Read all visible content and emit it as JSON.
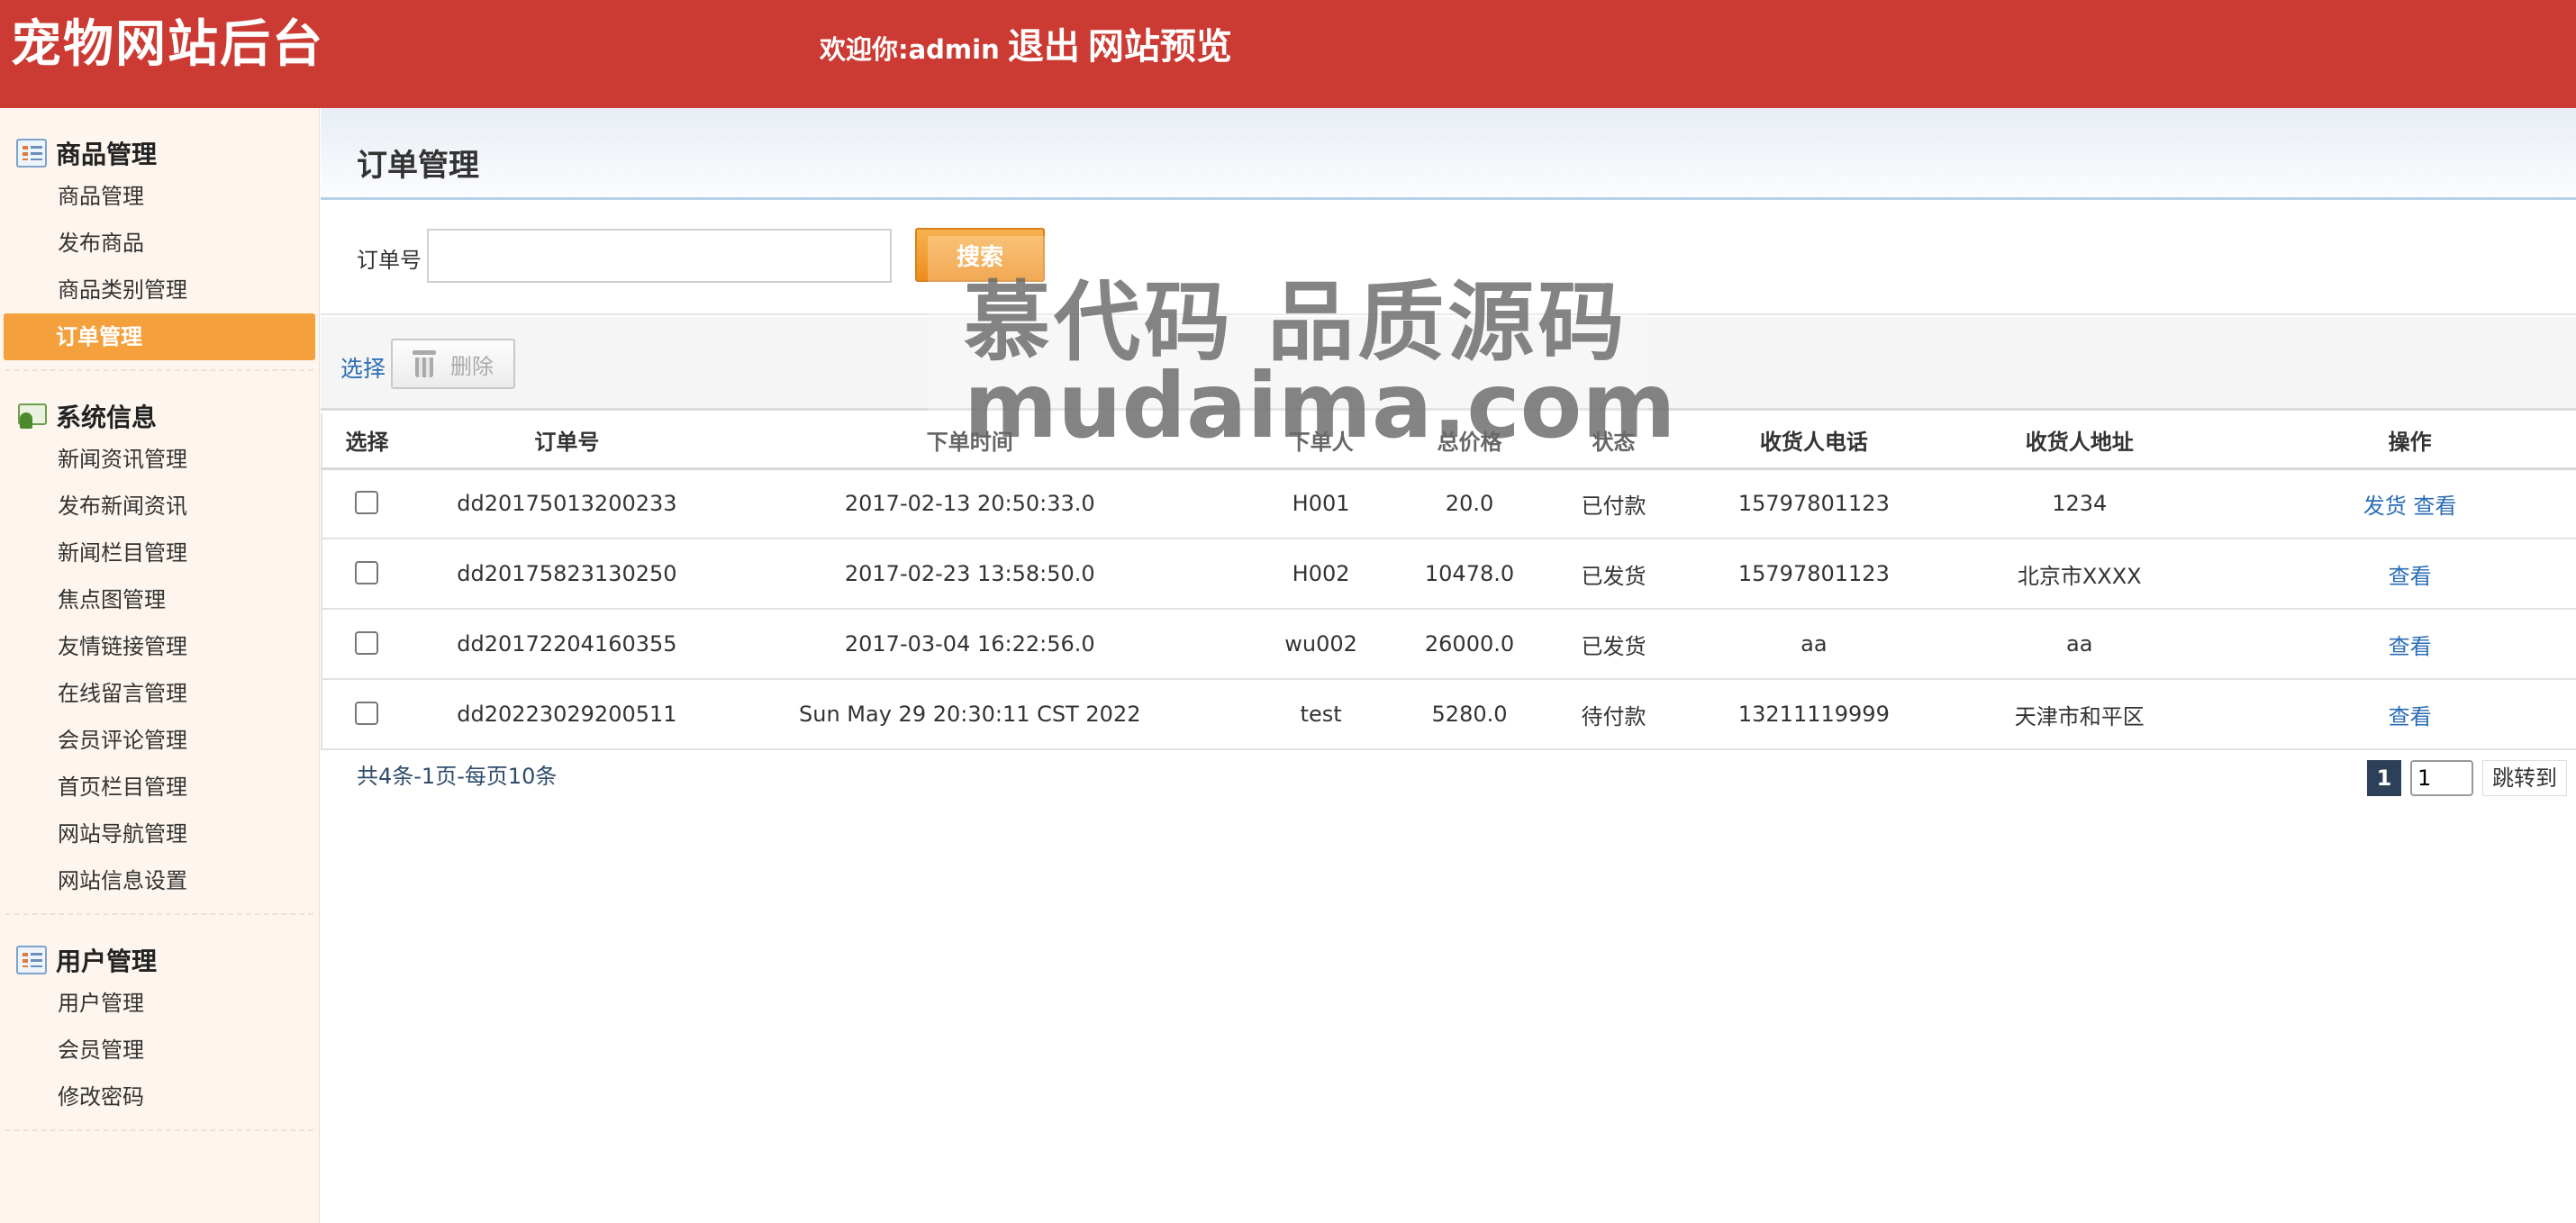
{
  "header": {
    "site_title": "宠物网站后台",
    "welcome": "欢迎你:admin",
    "logout": "退出",
    "preview": "网站预览"
  },
  "sidebar": {
    "groups": [
      {
        "title": "商品管理",
        "icon": "list-icon",
        "items": [
          "商品管理",
          "发布商品",
          "商品类别管理",
          "订单管理"
        ]
      },
      {
        "title": "系统信息",
        "icon": "people-icon",
        "items": [
          "新闻资讯管理",
          "发布新闻资讯",
          "新闻栏目管理",
          "焦点图管理",
          "友情链接管理",
          "在线留言管理",
          "会员评论管理",
          "首页栏目管理",
          "网站导航管理",
          "网站信息设置"
        ]
      },
      {
        "title": "用户管理",
        "icon": "list-icon",
        "items": [
          "用户管理",
          "会员管理",
          "修改密码"
        ]
      }
    ],
    "active_item": "订单管理"
  },
  "main": {
    "page_title": "订单管理",
    "search": {
      "label": "订单号",
      "value": "",
      "placeholder": "",
      "button": "搜索"
    },
    "toolbar": {
      "select": "选择",
      "delete": "删除"
    },
    "table": {
      "headers": [
        "选择",
        "订单号",
        "下单时间",
        "下单人",
        "总价格",
        "状态",
        "收货人电话",
        "收货人地址",
        "操作"
      ],
      "rows": [
        {
          "order_no": "dd20175013200233",
          "time": "2017-02-13 20:50:33.0",
          "user": "H001",
          "total": "20.0",
          "status": "已付款",
          "phone": "15797801123",
          "address": "1234",
          "actions": [
            "发货",
            "查看"
          ]
        },
        {
          "order_no": "dd20175823130250",
          "time": "2017-02-23 13:58:50.0",
          "user": "H002",
          "total": "10478.0",
          "status": "已发货",
          "phone": "15797801123",
          "address": "北京市XXXX",
          "actions": [
            "查看"
          ]
        },
        {
          "order_no": "dd20172204160355",
          "time": "2017-03-04 16:22:56.0",
          "user": "wu002",
          "total": "26000.0",
          "status": "已发货",
          "phone": "aa",
          "address": "aa",
          "actions": [
            "查看"
          ]
        },
        {
          "order_no": "dd20223029200511",
          "time": "Sun May 29 20:30:11 CST 2022",
          "user": "test",
          "total": "5280.0",
          "status": "待付款",
          "phone": "13211119999",
          "address": "天津市和平区",
          "actions": [
            "查看"
          ]
        }
      ]
    },
    "pagination": {
      "info": "共4条-1页-每页10条",
      "current_page": "1",
      "input_value": "1",
      "jump": "跳转到"
    }
  },
  "watermark": {
    "line1": "慕代码 品质源码",
    "line2": "mudaima.com"
  },
  "colors": {
    "header_bg": "#cc3b33",
    "active_menu": "#f4a03c",
    "search_button": "#ee8d1c",
    "link": "#2b6db5",
    "pager_current": "#2c4159"
  }
}
